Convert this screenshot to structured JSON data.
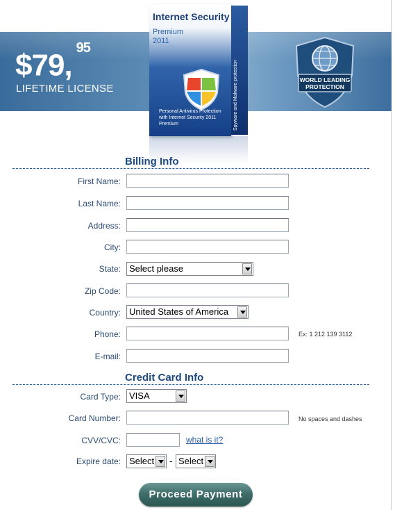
{
  "header": {
    "price_main": "$79,",
    "price_cents": "95",
    "license_label": "LIFETIME LICENSE",
    "product_box": {
      "title": "Internet Security",
      "subtitle_line1": "Premium",
      "subtitle_line2": "2011",
      "front_text": "Personal Antivirus Protection with Internet Security 2011 Premium",
      "side_text": "Spyware and Malware protection"
    },
    "badge": {
      "line1": "WORLD LEADING",
      "line2": "PROTECTION"
    }
  },
  "billing": {
    "title": "Billing Info",
    "first_name_label": "First Name:",
    "last_name_label": "Last Name:",
    "address_label": "Address:",
    "city_label": "City:",
    "state_label": "State:",
    "state_value": "Select please",
    "zip_label": "Zip Code:",
    "country_label": "Country:",
    "country_value": "United States of America",
    "phone_label": "Phone:",
    "phone_hint": "Ex: 1 212 139 3112",
    "email_label": "E-mail:"
  },
  "card": {
    "title": "Credit Card Info",
    "type_label": "Card Type:",
    "type_value": "VISA",
    "number_label": "Card Number:",
    "number_hint": "No spaces and dashes",
    "cvv_label": "CVV/CVC:",
    "cvv_link": "what is it?",
    "expire_label": "Expire date:",
    "expire_month": "Select",
    "expire_sep": "-",
    "expire_year": "Select"
  },
  "actions": {
    "proceed_label": "Proceed Payment"
  },
  "colors": {
    "banner": "#4a7aa8",
    "label_text": "#2a4a72",
    "section_title": "#1c4a80",
    "button": "#3f6e6b"
  }
}
